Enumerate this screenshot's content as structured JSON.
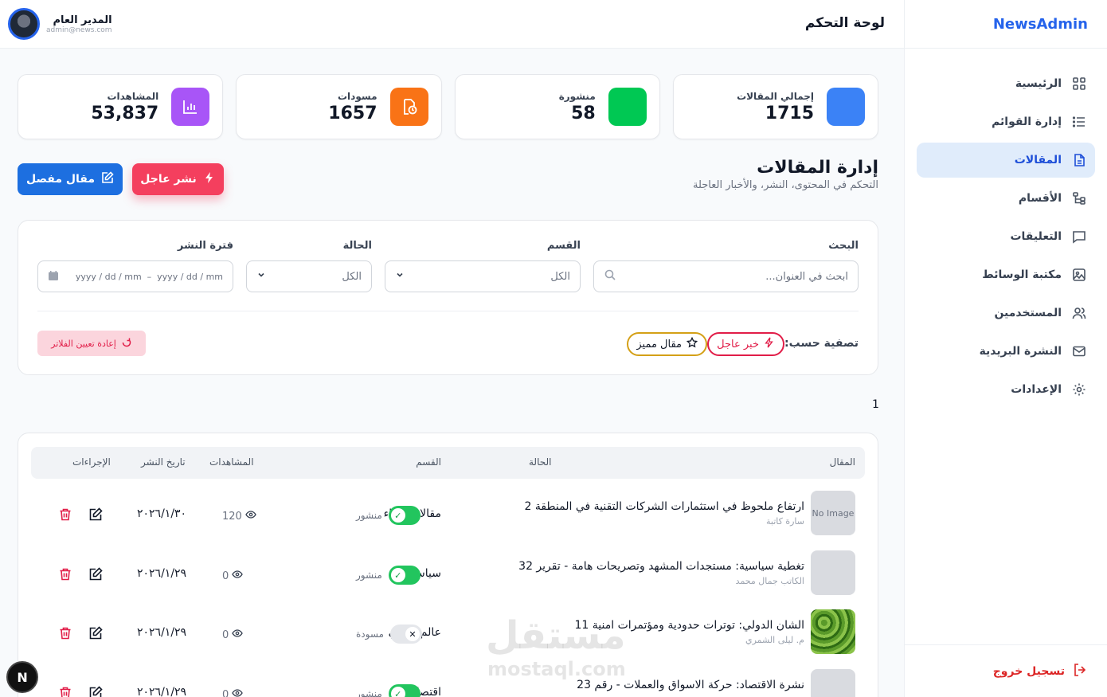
{
  "brand": "NewsAdmin",
  "topbar": {
    "title": "لوحة التحكم",
    "user_name": "المدير العام",
    "user_email": "admin@news.com"
  },
  "sidebar": {
    "items": [
      {
        "label": "الرئيسية",
        "icon": "grid-icon"
      },
      {
        "label": "إدارة القوائم",
        "icon": "list-icon"
      },
      {
        "label": "المقالات",
        "icon": "document-icon",
        "active": true
      },
      {
        "label": "الأقسام",
        "icon": "sitemap-icon"
      },
      {
        "label": "التعليقات",
        "icon": "comment-icon"
      },
      {
        "label": "مكتبة الوسائط",
        "icon": "image-icon"
      },
      {
        "label": "المستخدمين",
        "icon": "users-icon"
      },
      {
        "label": "النشرة البريدية",
        "icon": "mail-icon"
      },
      {
        "label": "الإعدادات",
        "icon": "gear-icon"
      }
    ],
    "logout": "تسجيل خروج"
  },
  "stats": [
    {
      "label": "إجمالي المقالات",
      "value": "1715",
      "color": "#3b82f6"
    },
    {
      "label": "منشورة",
      "value": "58",
      "color": "#00c853"
    },
    {
      "label": "مسودات",
      "value": "1657",
      "color": "#f97316"
    },
    {
      "label": "المشاهدات",
      "value": "53,837",
      "color": "#a855f7"
    }
  ],
  "section": {
    "title": "إدارة المقالات",
    "subtitle": "التحكم في المحتوى، النشر، والأخبار العاجلة",
    "urgent_btn": "نشر عاجل",
    "article_btn": "مقال مفصل"
  },
  "filters": {
    "search_label": "البحث",
    "search_placeholder": "ابحث في العنوان...",
    "category_label": "القسم",
    "category_value": "الكل",
    "status_label": "الحالة",
    "status_value": "الكل",
    "period_label": "فترة النشر",
    "period_value": "yyyy / dd / mm  –  yyyy / dd / mm",
    "filter_by": "تصفية حسب:",
    "chip_breaking": "خبر عاجل",
    "chip_featured": "مقال مميز",
    "reset": "إعادة تعيين الفلاتر"
  },
  "page_number": "1",
  "table": {
    "headers": {
      "article": "المقال",
      "category": "القسم",
      "status": "الحالة",
      "views": "المشاهدات",
      "date": "تاريخ النشر",
      "actions": "الإجراءات"
    },
    "rows": [
      {
        "title": "ارتفاع ملحوظ في استثمارات الشركات التقنية في المنطقة 2",
        "author": "سارة كاتبة",
        "category": "مقالات وآراء",
        "status": "منشور",
        "published": true,
        "views": "120",
        "date": "٢٠٢٦/١/٣٠",
        "thumb": "No Image"
      },
      {
        "title": "تغطية سياسية: مستجدات المشهد وتصريحات هامة - تقرير 32",
        "author": "الكاتب جمال محمد",
        "category": "سياسة",
        "status": "منشور",
        "published": true,
        "views": "0",
        "date": "٢٠٢٦/١/٢٩",
        "thumb": ""
      },
      {
        "title": "الشان الدولي: توترات حدودية ومؤتمرات امنية 11",
        "author": "م. ليلى الشمري",
        "category": "عالم ودولي",
        "status": "مسودة",
        "published": false,
        "views": "0",
        "date": "٢٠٢٦/١/٢٩",
        "thumb": ""
      },
      {
        "title": "نشرة الاقتصاد: حركة الاسواق والعملات - رقم 23",
        "author": "",
        "category": "اقتصاد",
        "status": "منشور",
        "published": true,
        "views": "0",
        "date": "٢٠٢٦/١/٢٩",
        "thumb": ""
      }
    ]
  },
  "watermark": {
    "arabic": "مستقل",
    "latin": "mostaql.com"
  },
  "badge": "N"
}
